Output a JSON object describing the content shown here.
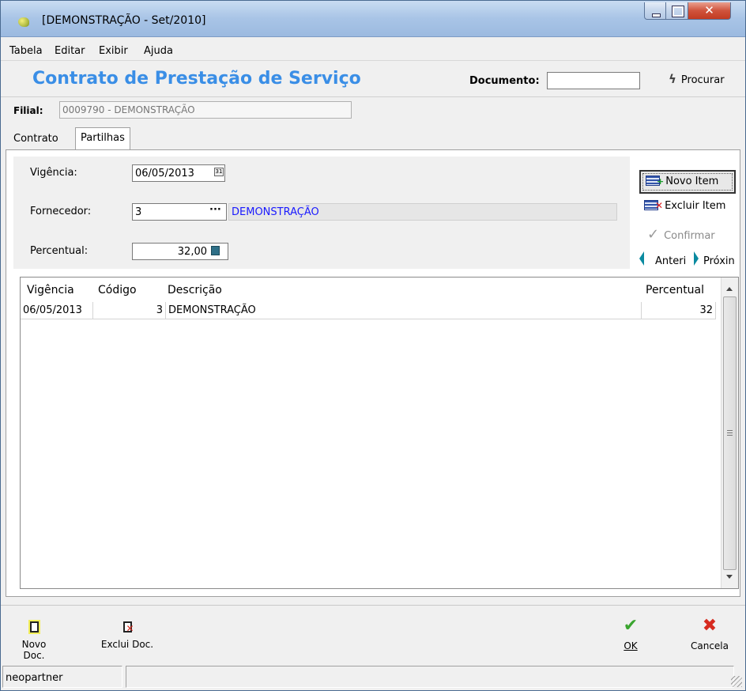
{
  "window": {
    "title": "[DEMONSTRAÇÃO - Set/2010]"
  },
  "menu": [
    "Tabela",
    "Editar",
    "Exibir",
    "Ajuda"
  ],
  "header": {
    "title": "Contrato de Prestação de Serviço",
    "document_label": "Documento:",
    "document_value": "",
    "search_label": "Procurar"
  },
  "filial": {
    "label": "Filial:",
    "value": "0009790 - DEMONSTRAÇÃO"
  },
  "tabs": [
    "Contrato",
    "Partilhas"
  ],
  "form": {
    "vigencia_label": "Vigência:",
    "vigencia_value": "06/05/2013",
    "fornecedor_label": "Fornecedor:",
    "fornecedor_code": "3",
    "fornecedor_name": "DEMONSTRAÇÃO",
    "percentual_label": "Percentual:",
    "percentual_value": "32,00"
  },
  "actions": {
    "novo_item": "Novo Item",
    "excluir_item": "Excluir Item",
    "confirmar": "Confirmar",
    "anterior": "Anteri",
    "proximo": "Próxin"
  },
  "grid": {
    "columns": [
      "Vigência",
      "Código",
      "Descrição",
      "Percentual"
    ],
    "rows": [
      {
        "vigencia": "06/05/2013",
        "codigo": "3",
        "descricao": "DEMONSTRAÇÃO",
        "percentual": "32"
      }
    ]
  },
  "bottom": {
    "novo_doc": "Novo Doc.",
    "exclui_doc": "Exclui Doc.",
    "ok": "OK",
    "cancela": "Cancela"
  },
  "status": {
    "user": "neopartner"
  },
  "colors": {
    "title_blue": "#3a8ee6",
    "link_blue": "#1a1aff",
    "ok_green": "#3aa52f",
    "cancel_red": "#d62a1f"
  }
}
